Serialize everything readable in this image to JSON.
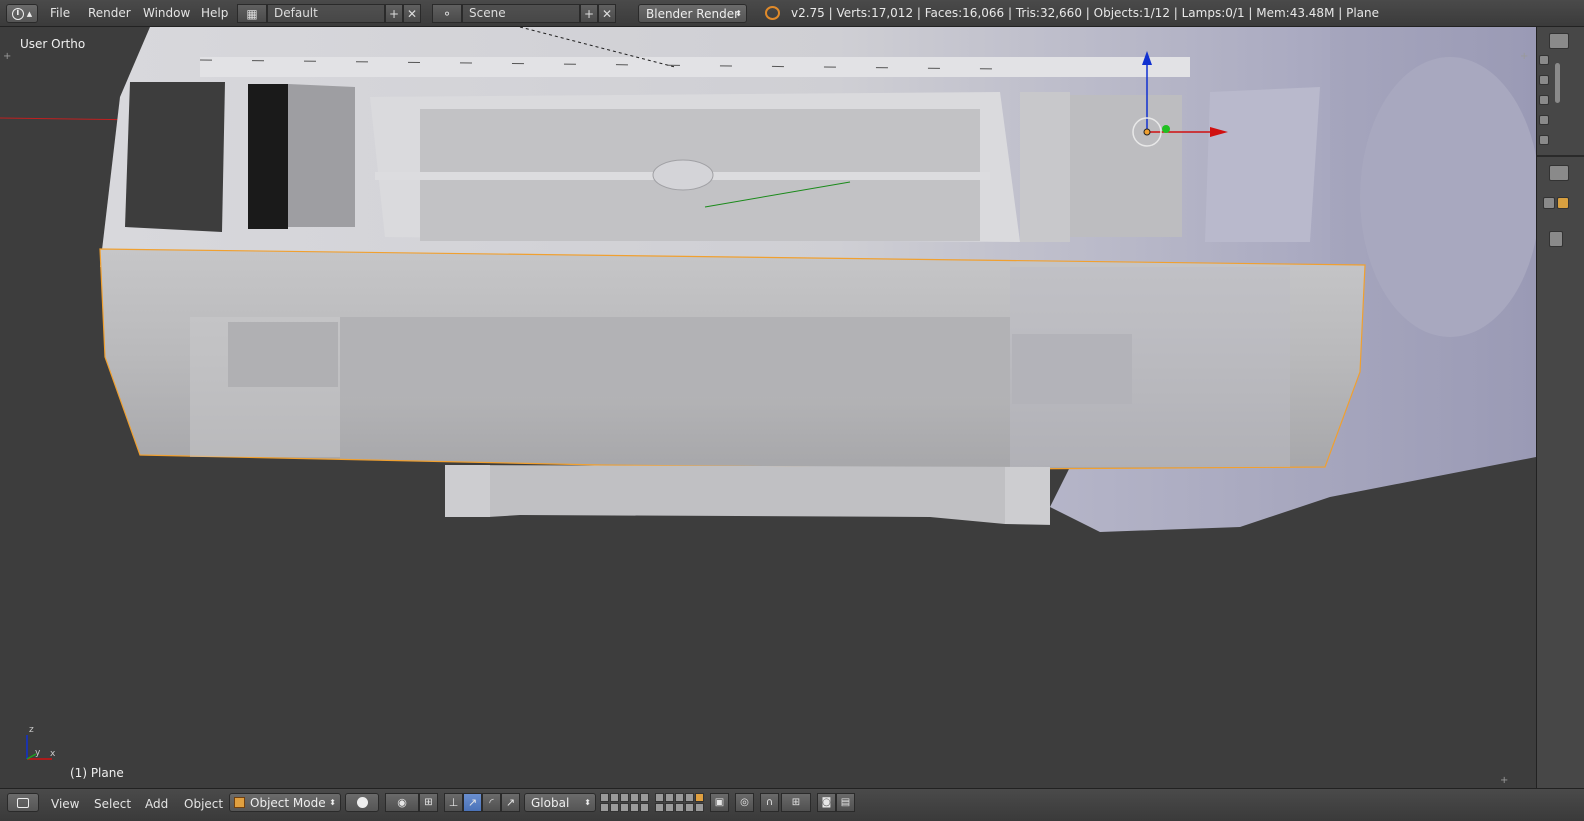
{
  "topbar": {
    "editor_icon": "info-icon",
    "menus": [
      "File",
      "Render",
      "Window",
      "Help"
    ],
    "screen_layout": "Default",
    "scene": "Scene",
    "render_engine": "Blender Render",
    "stats": "v2.75 | Verts:17,012 | Faces:16,066 | Tris:32,660 | Objects:1/12 | Lamps:0/1 | Mem:43.48M | Plane"
  },
  "viewport": {
    "view_name": "User Ortho",
    "object_label": "(1) Plane",
    "axis_labels": {
      "x": "x",
      "y": "y",
      "z": "z"
    }
  },
  "bottombar": {
    "menus": [
      "View",
      "Select",
      "Add",
      "Object"
    ],
    "mode": "Object Mode",
    "orientation": "Global"
  },
  "colors": {
    "selection_outline": "#f0a030",
    "x_axis": "#d01010",
    "y_axis": "#10a010",
    "z_axis": "#1030d0",
    "background": "#3d3d3d"
  }
}
